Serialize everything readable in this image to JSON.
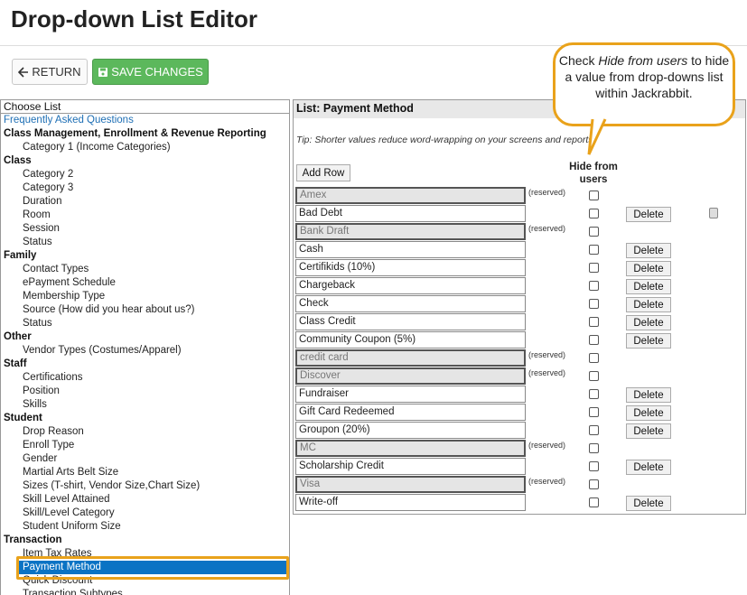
{
  "page": {
    "title": "Drop-down List Editor"
  },
  "toolbar": {
    "return_label": "RETURN",
    "save_label": "SAVE CHANGES"
  },
  "left": {
    "header": "Choose List",
    "items": [
      {
        "type": "faq",
        "label": "Frequently Asked Questions"
      },
      {
        "type": "cat",
        "label": "Class Management, Enrollment & Revenue Reporting"
      },
      {
        "type": "item",
        "label": "Category 1 (Income Categories)"
      },
      {
        "type": "cat",
        "label": "Class"
      },
      {
        "type": "item",
        "label": "Category 2"
      },
      {
        "type": "item",
        "label": "Category 3"
      },
      {
        "type": "item",
        "label": "Duration"
      },
      {
        "type": "item",
        "label": "Room"
      },
      {
        "type": "item",
        "label": "Session"
      },
      {
        "type": "item",
        "label": "Status"
      },
      {
        "type": "cat",
        "label": "Family"
      },
      {
        "type": "item",
        "label": "Contact Types"
      },
      {
        "type": "item",
        "label": "ePayment Schedule"
      },
      {
        "type": "item",
        "label": "Membership Type"
      },
      {
        "type": "item",
        "label": "Source (How did you hear about us?)"
      },
      {
        "type": "item",
        "label": "Status"
      },
      {
        "type": "cat",
        "label": "Other"
      },
      {
        "type": "item",
        "label": "Vendor Types (Costumes/Apparel)"
      },
      {
        "type": "cat",
        "label": "Staff"
      },
      {
        "type": "item",
        "label": "Certifications"
      },
      {
        "type": "item",
        "label": "Position"
      },
      {
        "type": "item",
        "label": "Skills"
      },
      {
        "type": "cat",
        "label": "Student"
      },
      {
        "type": "item",
        "label": "Drop Reason"
      },
      {
        "type": "item",
        "label": "Enroll Type"
      },
      {
        "type": "item",
        "label": "Gender"
      },
      {
        "type": "item",
        "label": "Martial Arts Belt Size"
      },
      {
        "type": "item",
        "label": "Sizes (T-shirt, Vendor Size,Chart Size)"
      },
      {
        "type": "item",
        "label": "Skill Level Attained"
      },
      {
        "type": "item",
        "label": "Skill/Level Category"
      },
      {
        "type": "item",
        "label": "Student Uniform Size"
      },
      {
        "type": "cat",
        "label": "Transaction"
      },
      {
        "type": "item",
        "label": "Item Tax Rates"
      },
      {
        "type": "selected",
        "label": "Payment Method"
      },
      {
        "type": "item",
        "label": "Quick Discount"
      },
      {
        "type": "item",
        "label": "Transaction Subtypes"
      }
    ]
  },
  "right": {
    "header": "List: Payment Method",
    "tip": "Tip: Shorter values reduce word-wrapping on your screens and reports.",
    "add_row_label": "Add Row",
    "hide_header": "Hide from users",
    "reserved_label": "(reserved)",
    "delete_label": "Delete",
    "values": [
      {
        "label": "Amex",
        "reserved": true
      },
      {
        "label": "Bad Debt",
        "reserved": false,
        "icon": true
      },
      {
        "label": "Bank Draft",
        "reserved": true
      },
      {
        "label": "Cash",
        "reserved": false
      },
      {
        "label": "Certifikids (10%)",
        "reserved": false
      },
      {
        "label": "Chargeback",
        "reserved": false
      },
      {
        "label": "Check",
        "reserved": false
      },
      {
        "label": "Class Credit",
        "reserved": false
      },
      {
        "label": "Community Coupon (5%)",
        "reserved": false
      },
      {
        "label": "credit card",
        "reserved": true
      },
      {
        "label": "Discover",
        "reserved": true
      },
      {
        "label": "Fundraiser",
        "reserved": false
      },
      {
        "label": "Gift Card Redeemed",
        "reserved": false
      },
      {
        "label": "Groupon (20%)",
        "reserved": false
      },
      {
        "label": "MC",
        "reserved": true
      },
      {
        "label": "Scholarship Credit",
        "reserved": false
      },
      {
        "label": "Visa",
        "reserved": true
      },
      {
        "label": "Write-off",
        "reserved": false
      }
    ]
  },
  "callout": {
    "pre": "Check ",
    "em": "Hide from users",
    "post": " to hide a value from drop-downs list within Jackrabbit."
  },
  "colors": {
    "accent": "#e9a21b",
    "save": "#5cb85c",
    "selected": "#0a73c4"
  }
}
